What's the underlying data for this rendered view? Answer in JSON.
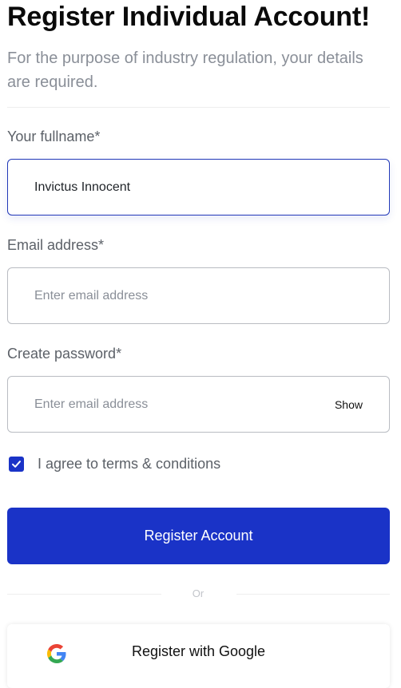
{
  "header": {
    "title": "Register Individual Account!",
    "subtitle": "For the purpose of industry regulation, your details are required."
  },
  "form": {
    "fullname": {
      "label": "Your fullname*",
      "value": "Invictus Innocent"
    },
    "email": {
      "label": "Email address*",
      "placeholder": "Enter email address"
    },
    "password": {
      "label": "Create password*",
      "placeholder": "Enter email address",
      "toggle_label": "Show"
    },
    "agree": {
      "checked": true,
      "label": "I agree to terms & conditions"
    }
  },
  "actions": {
    "register_label": "Register Account",
    "separator": "Or",
    "google_label": "Register with Google"
  },
  "colors": {
    "primary": "#1A33C7",
    "active_border": "#2138B8",
    "muted_text": "#8A8F98",
    "label_text": "#5C6168"
  },
  "icons": {
    "checkbox": "check-icon",
    "google": "google-logo-icon"
  }
}
